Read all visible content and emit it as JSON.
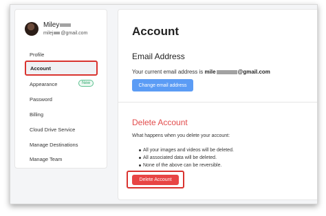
{
  "user": {
    "name": "Miley",
    "email_prefix": "milej",
    "email_domain": "@gmail.com"
  },
  "sidebar": {
    "items": [
      {
        "label": "Profile"
      },
      {
        "label": "Account"
      },
      {
        "label": "Appearance",
        "badge": "New"
      },
      {
        "label": "Password"
      },
      {
        "label": "Billing"
      },
      {
        "label": "Cloud Drive Service"
      },
      {
        "label": "Manage Destinations"
      },
      {
        "label": "Manage Team"
      }
    ]
  },
  "main": {
    "title": "Account",
    "email_section": {
      "title": "Email Address",
      "text_prefix": "Your current email address is ",
      "email_prefix": "mile",
      "email_suffix": "@gmail.com",
      "button": "Change email address"
    },
    "delete_section": {
      "title": "Delete Account",
      "description": "What happens when you delete your account:",
      "bullets": [
        "All your images and videos will be deleted.",
        "All associated data will be deleted.",
        "None of the above can be reversible."
      ],
      "button": "Delete Account"
    }
  },
  "colors": {
    "accent": "#5b9cf5",
    "danger": "#e84545",
    "highlight": "#d9322e",
    "badge": "#2aa66a"
  }
}
